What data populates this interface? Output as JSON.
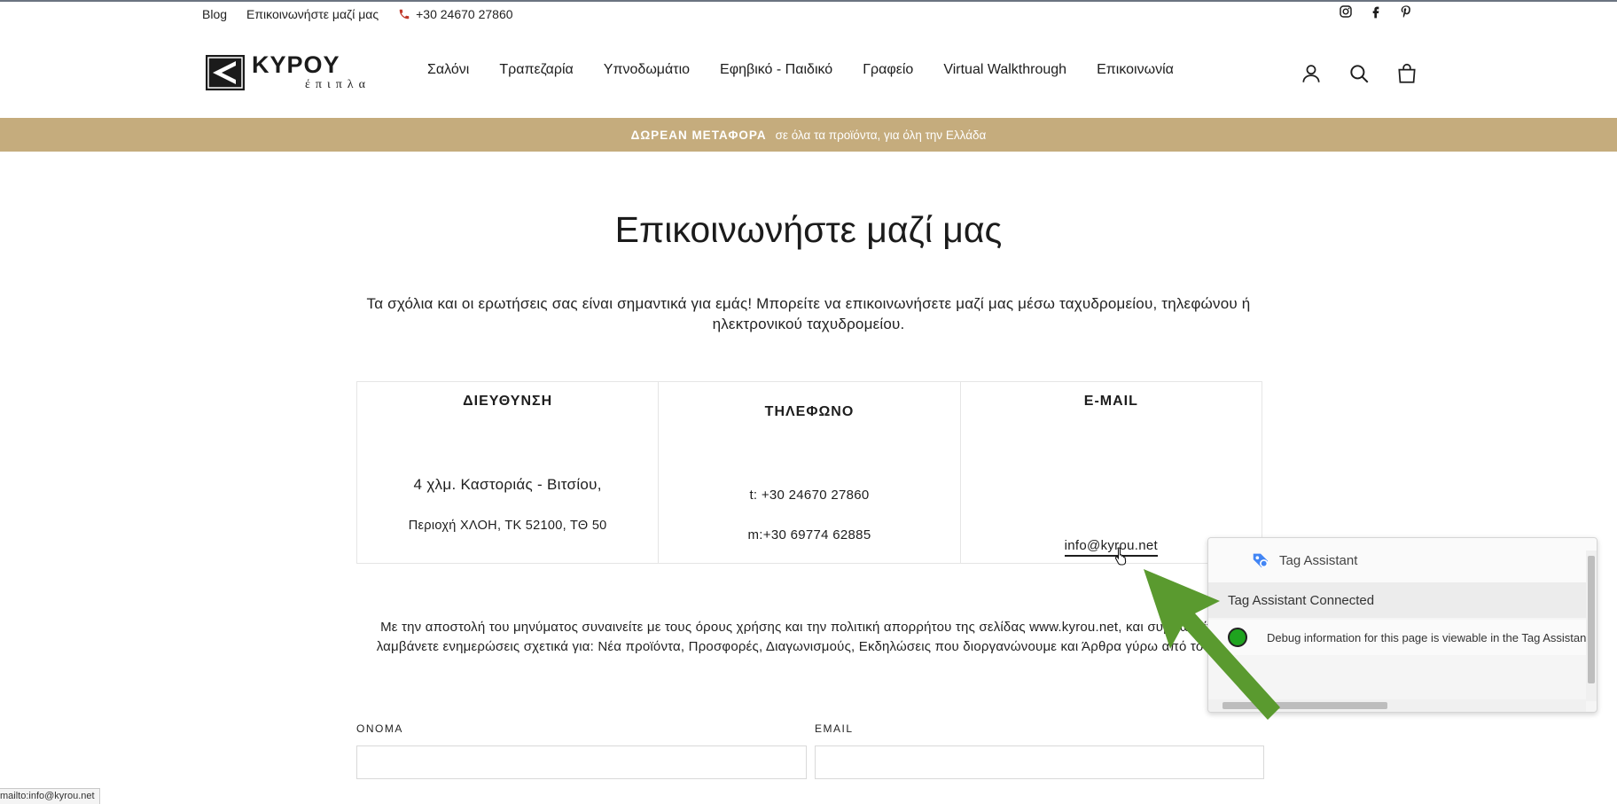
{
  "utility": {
    "links": [
      "Blog",
      "Επικοινωνήστε μαζί μας"
    ],
    "phone": "+30 24670 27860",
    "social_icons": [
      "instagram-icon",
      "facebook-icon",
      "pinterest-icon"
    ]
  },
  "header": {
    "logo_main": "KYPOY",
    "logo_sub": "έπιπλα",
    "nav": [
      "Σαλόνι",
      "Τραπεζαρία",
      "Υπνοδωμάτιο",
      "Εφηβικό - Παιδικό",
      "Γραφείο",
      "Virtual Walkthrough",
      "Επικοινωνία"
    ],
    "icons": [
      "account-icon",
      "search-icon",
      "cart-icon"
    ]
  },
  "promo": {
    "bold": "ΔΩΡΕΑΝ ΜΕΤΑΦΟΡΑ",
    "text": "σε όλα τα προϊόντα, για όλη την Ελλάδα",
    "color": "#c5ac7d"
  },
  "page": {
    "title": "Επικοινωνήστε μαζί μας",
    "intro": "Τα σχόλια και οι ερωτήσεις σας είναι σημαντικά για εμάς! Μπορείτε να επικοινωνήσετε μαζί μας μέσω ταχυδρομείου, τηλεφώνου ή ηλεκτρονικού ταχυδρομείου."
  },
  "contact": {
    "address": {
      "header": "ΔΙΕΥΘΥΝΣΗ",
      "line1": "4 χλμ. Καστοριάς - Βιτσίου,",
      "line2": "Περιοχή ΧΛΟΗ, ΤΚ 52100, ΤΘ 50"
    },
    "phone": {
      "header": "ΤΗΛΕΦΩΝΟ",
      "line1": "t:  +30 24670 27860",
      "line2": "m:+30 69774 62885"
    },
    "email": {
      "header": "E-MAIL",
      "address": "info@kyrou.net"
    }
  },
  "terms": "Με την αποστολή του μηνύματος συναινείτε με τους όρους χρήσης και την πολιτική απορρήτου της σελίδας www.kyrou.net, και συμφωνείτε να λαμβάνετε ενημερώσεις σχετικά για: Νέα προϊόντα, Προσφορές, Διαγωνισμούς, Εκδηλώσεις που διοργανώνουμε και Άρθρα γύρω από το σπίτι.",
  "form": {
    "name_label": "ΟΝΟΜΑ",
    "email_label": "EMAIL",
    "name_value": "",
    "email_value": ""
  },
  "status_bar": "mailto:info@kyrou.net",
  "tag_assistant": {
    "title": "Tag Assistant",
    "connected": "Tag Assistant Connected",
    "debug_text": "Debug information for this page is viewable in the Tag Assistant window.",
    "status_color": "#1fa31f"
  },
  "annotation": {
    "arrow_color": "#5a9a2f"
  }
}
